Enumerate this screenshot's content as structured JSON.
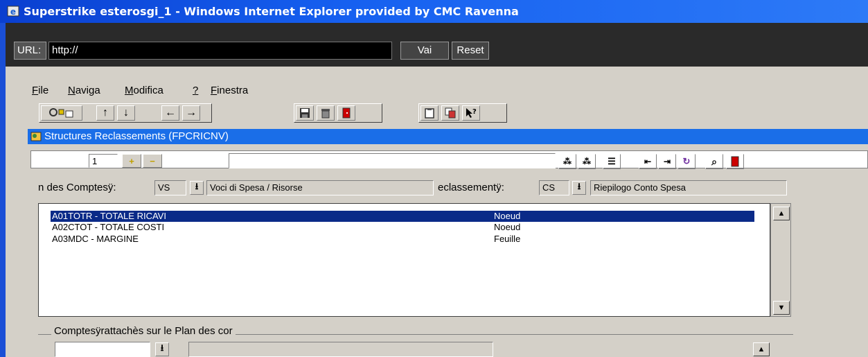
{
  "window": {
    "title": "Superstrike esterosgi_1 - Windows Internet Explorer provided by CMC Ravenna"
  },
  "urlbar": {
    "label": "URL:",
    "value": "http://",
    "go_label": "Vai",
    "reset_label": "Reset"
  },
  "menu": [
    {
      "label": "File",
      "accel": "F",
      "rest": "ile"
    },
    {
      "label": "Naviga",
      "accel": "N",
      "rest": "aviga"
    },
    {
      "label": "Modifica",
      "accel": "M",
      "rest": "odifica"
    },
    {
      "label": "?",
      "accel": "?",
      "rest": ""
    },
    {
      "label": "Finestra",
      "accel": "F",
      "rest": "inestra"
    }
  ],
  "form": {
    "title": "Structures Reclassements (FPCRICNV)",
    "record_number": "1",
    "search_value": "",
    "plan_label": "n des Comptesÿ:",
    "plan_code": "VS",
    "plan_desc": "Voci di Spesa / Risorse",
    "reclass_label": "eclassementÿ:",
    "reclass_code": "CS",
    "reclass_desc": "Riepilogo Conto Spesa",
    "rows": [
      {
        "code": "A01TOTR - TOTALE RICAVI",
        "type": "Noeud",
        "selected": true
      },
      {
        "code": "A02CTOT - TOTALE COSTI",
        "type": "Noeud",
        "selected": false
      },
      {
        "code": "A03MDC - MARGINE",
        "type": "Feuille",
        "selected": false
      }
    ],
    "group_label": "Comptesÿrattachès sur le Plan des cor"
  },
  "colors": {
    "titlebar": "#0a3fd0",
    "selection": "#0a2a88",
    "window_bg": "#d4d0c8"
  }
}
